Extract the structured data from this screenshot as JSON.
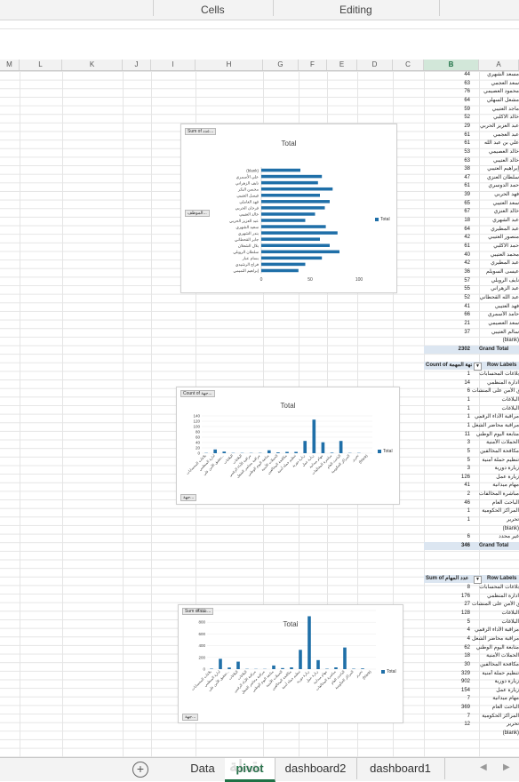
{
  "ribbon": {
    "groups": [
      "Cells",
      "Editing"
    ]
  },
  "columns": [
    "M",
    "L",
    "K",
    "J",
    "I",
    "H",
    "G",
    "F",
    "E",
    "D",
    "C",
    "B",
    "A"
  ],
  "tabs": {
    "add_label": "+",
    "sheets": [
      "Data",
      "pivot",
      "dashboard2",
      "dashboard1"
    ],
    "active": "pivot"
  },
  "pivot1": {
    "rows": [
      {
        "v": "44",
        "l": "مسعد الشهري"
      },
      {
        "v": "63",
        "l": "سعد العجمي"
      },
      {
        "v": "76",
        "l": "محمود العصيمي"
      },
      {
        "v": "64",
        "l": "مشعل السهلي"
      },
      {
        "v": "59",
        "l": "ماجد العتيبي"
      },
      {
        "v": "52",
        "l": "خالد الاكلبي"
      },
      {
        "v": "29",
        "l": "عبد العزيز الحربي"
      },
      {
        "v": "61",
        "l": "عبد العجمي"
      },
      {
        "v": "61",
        "l": "علي بن عبد الله"
      },
      {
        "v": "53",
        "l": "خالد العصيمي"
      },
      {
        "v": "63",
        "l": "خالد العتيبي"
      },
      {
        "v": "38",
        "l": "إبراهيم العتيبي"
      },
      {
        "v": "47",
        "l": "سلطان العنزي"
      },
      {
        "v": "61",
        "l": "حمد الدوسري"
      },
      {
        "v": "39",
        "l": "فهد الحربي"
      },
      {
        "v": "65",
        "l": "سعد العتيبي"
      },
      {
        "v": "67",
        "l": "خالد العنزي"
      },
      {
        "v": "18",
        "l": "عبد الشهري"
      },
      {
        "v": "64",
        "l": "عبد المطيري"
      },
      {
        "v": "42",
        "l": "منصور العتيبي"
      },
      {
        "v": "61",
        "l": "حمد الاكلبي"
      },
      {
        "v": "40",
        "l": "محمد العتيبي"
      },
      {
        "v": "42",
        "l": "عبد المطيري"
      },
      {
        "v": "36",
        "l": "عيسى السويلم"
      },
      {
        "v": "57",
        "l": "نايف الرويلي"
      },
      {
        "v": "55",
        "l": "عبد الزهراني"
      },
      {
        "v": "52",
        "l": "عبد الله القحطاني"
      },
      {
        "v": "41",
        "l": "فهد العتيبي"
      },
      {
        "v": "66",
        "l": "حامد الأسمري"
      },
      {
        "v": "21",
        "l": "سعد العصيمي"
      },
      {
        "v": "37",
        "l": "سالم العتيبي"
      },
      {
        "v": "",
        "l": "(blank)"
      }
    ],
    "grand": {
      "v": "2302",
      "l": "Grand Total"
    }
  },
  "pivot2": {
    "header": {
      "a": "Count of جهة المهمة",
      "b": "Row Labels"
    },
    "rows": [
      {
        "v": "1",
        "l": "بلاغات المحسابات"
      },
      {
        "v": "14",
        "l": "ادارة المنظمي"
      },
      {
        "v": "6",
        "l": "تحقيق الأمن على المنشآت"
      },
      {
        "v": "1",
        "l": "البلاغات"
      },
      {
        "v": "1",
        "l": "البلاغات"
      },
      {
        "v": "1",
        "l": "مراقبة الأداء الرقمي"
      },
      {
        "v": "1",
        "l": "مراقبة محاضر الشغل"
      },
      {
        "v": "11",
        "l": "متابعة اليوم الوطني"
      },
      {
        "v": "3",
        "l": "الحملات الأمنية"
      },
      {
        "v": "5",
        "l": "مكافحة المخالفين"
      },
      {
        "v": "5",
        "l": "تنظيم حملة أمنية"
      },
      {
        "v": "3",
        "l": "زيارة دورية"
      },
      {
        "v": "126",
        "l": "زيارة عمل"
      },
      {
        "v": "41",
        "l": "مهام ميدانية"
      },
      {
        "v": "2",
        "l": "مباشرة المخالفات"
      },
      {
        "v": "46",
        "l": "الباحث العام"
      },
      {
        "v": "1",
        "l": "المراكز الحكومية"
      },
      {
        "v": "1",
        "l": "تحرير"
      },
      {
        "v": "",
        "l": "(blank)"
      },
      {
        "v": "6",
        "l": "غير محدد"
      }
    ],
    "grand": {
      "v": "346",
      "l": "Grand Total"
    }
  },
  "pivot3": {
    "header": {
      "a": "Sum of عدد المهام",
      "b": "Row Labels"
    },
    "rows": [
      {
        "v": "8",
        "l": "بلاغات المحسابات"
      },
      {
        "v": "176",
        "l": "ادارة المنظمي"
      },
      {
        "v": "27",
        "l": "تحقيق الأمن على المنشآت"
      },
      {
        "v": "128",
        "l": "البلاغات"
      },
      {
        "v": "5",
        "l": "البلاغات"
      },
      {
        "v": "4",
        "l": "مراقبة الأداء الرقمي"
      },
      {
        "v": "4",
        "l": "مراقبة محاضر الشغل"
      },
      {
        "v": "62",
        "l": "متابعة اليوم الوطني"
      },
      {
        "v": "18",
        "l": "الحملات الأمنية"
      },
      {
        "v": "30",
        "l": "مكافحة المخالفين"
      },
      {
        "v": "329",
        "l": "تنظيم حملة أمنية"
      },
      {
        "v": "902",
        "l": "زيارة دورية"
      },
      {
        "v": "154",
        "l": "زيارة عمل"
      },
      {
        "v": "7",
        "l": "مهام ميدانية"
      },
      {
        "v": "369",
        "l": "الباحث العام"
      },
      {
        "v": "7",
        "l": "المراكز الحكومية"
      },
      {
        "v": "12",
        "l": "تحرير"
      },
      {
        "v": "",
        "l": "(blank)"
      }
    ]
  },
  "chart1": {
    "field_top": "Sum of عدد...",
    "field_side": "الموظف...",
    "legend": "Total",
    "chart_data": {
      "type": "bar",
      "title": "Total",
      "categories": [
        "(blank)",
        "علي الأسمري",
        "نايف الزهراني",
        "محسن البكر",
        "فيصل العتيبي",
        "فهد العاملي",
        "فرحان الحربي",
        "خالد العتيبي",
        "عبد العزيز الحربي",
        "سعيد الشهري",
        "بندر الشهري",
        "جابر القحطاني",
        "بلال الشعلان",
        "سلطان الرويلي",
        "بسام عبار",
        "فراج الرشيدي",
        "إبراهيم التميمي"
      ],
      "values": [
        40,
        62,
        58,
        73,
        60,
        70,
        65,
        55,
        45,
        66,
        78,
        60,
        70,
        80,
        62,
        45,
        38
      ],
      "xticks": [
        "0",
        "50",
        "100"
      ],
      "xlim": [
        0,
        100
      ]
    }
  },
  "chart2": {
    "field_top": "Count of جهة...",
    "field_bottom": "جهة...",
    "legend": "Total",
    "chart_data": {
      "type": "bar",
      "title": "Total",
      "categories": [
        "بلاغات المحسابات",
        "ادارة المنظمي",
        "تحقيق الأمن على...",
        "البلاغات",
        "البلاغات",
        "مراقبة الأداء الرقمي",
        "مراقبة محاضر الشغل",
        "متابعة اليوم الوطني",
        "الحملات الأمنية",
        "مكافحة المخالفين",
        "تنظيم حملة أمنية",
        "زيارة دورية",
        "زيارة عمل",
        "مهام ميدانية",
        "مباشرة المخالفات",
        "الباحث العام",
        "المراكز الحكومية",
        "تحرير",
        "(blank)"
      ],
      "values": [
        1,
        14,
        6,
        1,
        1,
        1,
        1,
        11,
        3,
        5,
        5,
        46,
        126,
        41,
        2,
        46,
        1,
        1,
        0
      ],
      "yticks": [
        "0",
        "20",
        "40",
        "60",
        "80",
        "100",
        "120",
        "140"
      ],
      "ylim": [
        0,
        140
      ]
    }
  },
  "chart3": {
    "field_top": "Sum of عدد...",
    "field_bottom": "جهة...",
    "legend": "Total",
    "chart_data": {
      "type": "bar",
      "title": "Total",
      "categories": [
        "بلاغات المحسابات",
        "ادارة المنظمي",
        "تحقيق الأمن على...",
        "البلاغات",
        "البلاغات",
        "مراقبة الأداء الرقمي",
        "مراقبة محاضر الشغل",
        "متابعة اليوم الوطني",
        "الحملات الأمنية",
        "مكافحة المخالفين",
        "تنظيم حملة أمنية",
        "زيارة دورية",
        "زيارة عمل",
        "مهام ميدانية",
        "مباشرة المخالفات",
        "الباحث العام",
        "المراكز الحكومية",
        "تحرير",
        "(blank)"
      ],
      "values": [
        8,
        176,
        27,
        128,
        5,
        4,
        4,
        62,
        18,
        30,
        329,
        902,
        154,
        7,
        30,
        369,
        7,
        12,
        0
      ],
      "yticks": [
        "0",
        "200",
        "400",
        "600",
        "800",
        "1000"
      ],
      "ylim": [
        0,
        1000
      ]
    }
  },
  "watermark": "نقطة"
}
